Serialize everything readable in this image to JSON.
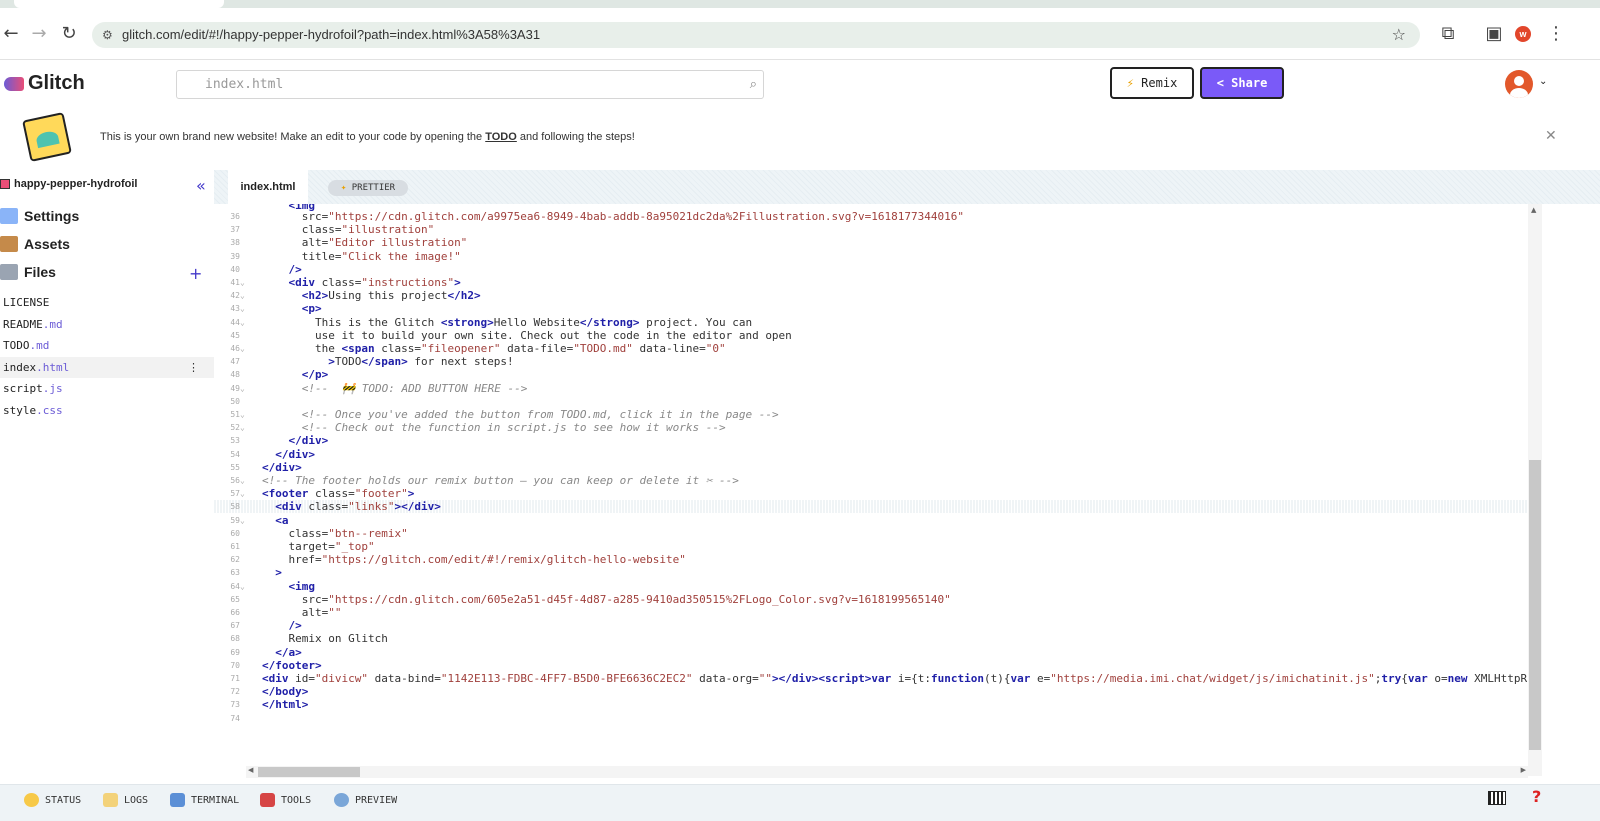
{
  "browser": {
    "url": "glitch.com/edit/#!/happy-pepper-hydrofoil?path=index.html%3A58%3A31",
    "profile_initial": "w"
  },
  "app": {
    "brand": "Glitch",
    "search_value": "index.html",
    "remix_label": "Remix",
    "share_label": "Share"
  },
  "banner": {
    "text_before": "This is your own brand new website! Make an edit to your code by opening the ",
    "link": "TODO",
    "text_after": " and following the steps!"
  },
  "sidebar": {
    "project": "happy-pepper-hydrofoil",
    "sections": [
      "Settings",
      "Assets",
      "Files"
    ],
    "files": [
      {
        "name": "LICENSE",
        "ext": ""
      },
      {
        "name": "README",
        "ext": ".md"
      },
      {
        "name": "TODO",
        "ext": ".md"
      },
      {
        "name": "index",
        "ext": ".html"
      },
      {
        "name": "script",
        "ext": ".js"
      },
      {
        "name": "style",
        "ext": ".css"
      }
    ],
    "active_file": "index.html"
  },
  "editor": {
    "tab": "index.html",
    "prettier": "PRETTIER",
    "lines": [
      {
        "n": "36",
        "html": "      src=<span class=\"s\">\"https://cdn.glitch.com/a9975ea6-8949-4bab-addb-8a95021dc2da%2Fillustration.svg?v=1618177344016\"</span>"
      },
      {
        "n": "37",
        "html": "      class=<span class=\"s\">\"illustration\"</span>"
      },
      {
        "n": "38",
        "html": "      alt=<span class=\"s\">\"Editor illustration\"</span>"
      },
      {
        "n": "39",
        "html": "      title=<span class=\"s\">\"Click the image!\"</span>"
      },
      {
        "n": "40",
        "html": "    <span class=\"t\">/&gt;</span>"
      },
      {
        "n": "41",
        "fold": true,
        "html": "    <span class=\"t\">&lt;div</span> class=<span class=\"s\">\"instructions\"</span><span class=\"t\">&gt;</span>"
      },
      {
        "n": "42",
        "fold": true,
        "html": "      <span class=\"t\">&lt;h2&gt;</span>Using this project<span class=\"t\">&lt;/h2&gt;</span>"
      },
      {
        "n": "43",
        "fold": true,
        "html": "      <span class=\"t\">&lt;p&gt;</span>"
      },
      {
        "n": "44",
        "fold": true,
        "html": "        This is the Glitch <span class=\"t\">&lt;strong&gt;</span>Hello Website<span class=\"t\">&lt;/strong&gt;</span> project. You can"
      },
      {
        "n": "45",
        "html": "        use it to build your own site. Check out the code in the editor and open"
      },
      {
        "n": "46",
        "fold": true,
        "html": "        the <span class=\"t\">&lt;span</span> class=<span class=\"s\">\"fileopener\"</span> data-file=<span class=\"s\">\"TODO.md\"</span> data-line=<span class=\"s\">\"0\"</span>"
      },
      {
        "n": "47",
        "html": "          <span class=\"t\">&gt;</span>TODO<span class=\"t\">&lt;/span&gt;</span> for next steps!"
      },
      {
        "n": "48",
        "html": "      <span class=\"t\">&lt;/p&gt;</span>"
      },
      {
        "n": "49",
        "fold": true,
        "html": "      <span class=\"c\">&lt;!--  &#x1F6A7; TODO: ADD BUTTON HERE --&gt;</span>"
      },
      {
        "n": "50",
        "html": ""
      },
      {
        "n": "51",
        "fold": true,
        "html": "      <span class=\"c\">&lt;!-- Once you've added the button from TODO.md, click it in the page --&gt;</span>"
      },
      {
        "n": "52",
        "fold": true,
        "html": "      <span class=\"c\">&lt;!-- Check out the function in script.js to see how it works --&gt;</span>"
      },
      {
        "n": "53",
        "html": "    <span class=\"t\">&lt;/div&gt;</span>"
      },
      {
        "n": "54",
        "html": "  <span class=\"t\">&lt;/div&gt;</span>"
      },
      {
        "n": "55",
        "html": "<span class=\"t\">&lt;/div&gt;</span>"
      },
      {
        "n": "56",
        "fold": true,
        "html": "<span class=\"c\">&lt;!-- The footer holds our remix button — you can keep or delete it ✂ --&gt;</span>"
      },
      {
        "n": "57",
        "fold": true,
        "html": "<span class=\"t\">&lt;footer</span> class=<span class=\"s\">\"footer\"</span><span class=\"t\">&gt;</span>"
      },
      {
        "n": "58",
        "hl": true,
        "html": "  <span class=\"t\">&lt;div</span> class=<span class=\"s\">\"links\"</span><span class=\"t\">&gt;&lt;/div&gt;</span>"
      },
      {
        "n": "59",
        "fold": true,
        "html": "  <span class=\"t\">&lt;a</span>"
      },
      {
        "n": "60",
        "html": "    class=<span class=\"s\">\"btn--remix\"</span>"
      },
      {
        "n": "61",
        "html": "    target=<span class=\"s\">\"_top\"</span>"
      },
      {
        "n": "62",
        "html": "    href=<span class=\"s\">\"https://glitch.com/edit/#!/remix/glitch-hello-website\"</span>"
      },
      {
        "n": "63",
        "html": "  <span class=\"t\">&gt;</span>"
      },
      {
        "n": "64",
        "fold": true,
        "html": "    <span class=\"t\">&lt;img</span>"
      },
      {
        "n": "65",
        "html": "      src=<span class=\"s\">\"https://cdn.glitch.com/605e2a51-d45f-4d87-a285-9410ad350515%2FLogo_Color.svg?v=1618199565140\"</span>"
      },
      {
        "n": "66",
        "html": "      alt=<span class=\"s\">\"\"</span>"
      },
      {
        "n": "67",
        "html": "    <span class=\"t\">/&gt;</span>"
      },
      {
        "n": "68",
        "html": "    Remix on Glitch"
      },
      {
        "n": "69",
        "html": "  <span class=\"t\">&lt;/a&gt;</span>"
      },
      {
        "n": "70",
        "html": "<span class=\"t\">&lt;/footer&gt;</span>"
      },
      {
        "n": "71",
        "html": "<span class=\"t\">&lt;div</span> id=<span class=\"s\">\"divicw\"</span> data-bind=<span class=\"s\">\"1142E113-FDBC-4FF7-B5D0-BFE6636C2EC2\"</span> data-org=<span class=\"s\">\"\"</span><span class=\"t\">&gt;&lt;/div&gt;&lt;script&gt;</span><span class=\"k\">var</span> i={t:<span class=\"k\">function</span>(t){<span class=\"k\">var</span> e=<span class=\"s\">\"https://media.imi.chat/widget/js/imichatinit.js\"</span>;<span class=\"k\">try</span>{<span class=\"k\">var</span> o=<span class=\"k\">new</span> XMLHttpR"
      },
      {
        "n": "72",
        "html": "<span class=\"t\">&lt;/body&gt;</span>"
      },
      {
        "n": "73",
        "html": "<span class=\"t\">&lt;/html&gt;</span>"
      },
      {
        "n": "74",
        "html": ""
      }
    ]
  },
  "footer": {
    "items": [
      "STATUS",
      "LOGS",
      "TERMINAL",
      "TOOLS",
      "PREVIEW"
    ]
  },
  "colors": {
    "accent": "#7a5af8",
    "tag": "#2020a8",
    "string": "#a0403c",
    "comment": "#888888"
  }
}
